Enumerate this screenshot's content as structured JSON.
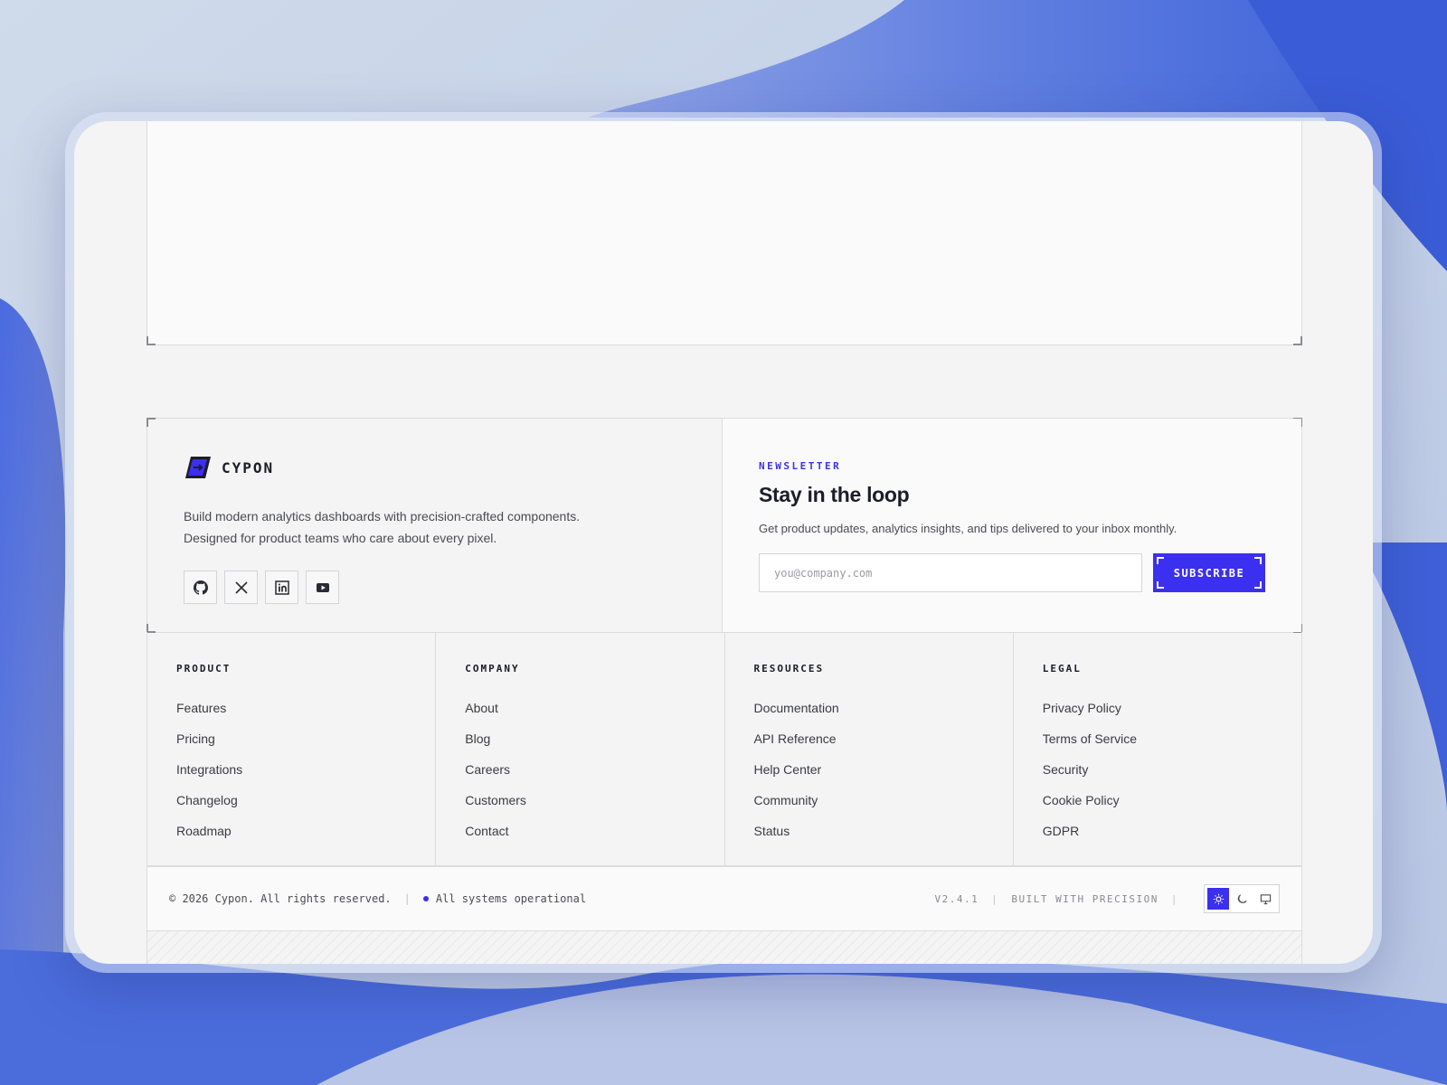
{
  "brand": {
    "name": "CYPON",
    "description": "Build modern analytics dashboards with precision-crafted components. Designed for product teams who care about every pixel.",
    "accent_color": "#3b2ff0"
  },
  "socials": [
    {
      "icon": "github-icon"
    },
    {
      "icon": "x-icon"
    },
    {
      "icon": "linkedin-icon"
    },
    {
      "icon": "youtube-icon"
    }
  ],
  "newsletter": {
    "eyebrow": "NEWSLETTER",
    "title": "Stay in the loop",
    "description": "Get product updates, analytics insights, and tips delivered to your inbox monthly.",
    "email_placeholder": "you@company.com",
    "email_value": "",
    "subscribe_label": "SUBSCRIBE"
  },
  "columns": [
    {
      "heading": "PRODUCT",
      "links": [
        "Features",
        "Pricing",
        "Integrations",
        "Changelog",
        "Roadmap"
      ]
    },
    {
      "heading": "COMPANY",
      "links": [
        "About",
        "Blog",
        "Careers",
        "Customers",
        "Contact"
      ]
    },
    {
      "heading": "RESOURCES",
      "links": [
        "Documentation",
        "API Reference",
        "Help Center",
        "Community",
        "Status"
      ]
    },
    {
      "heading": "LEGAL",
      "links": [
        "Privacy Policy",
        "Terms of Service",
        "Security",
        "Cookie Policy",
        "GDPR"
      ]
    }
  ],
  "bottom_bar": {
    "copyright": "© 2026 Cypon. All rights reserved.",
    "status": "All systems operational",
    "version": "V2.4.1",
    "tagline": "BUILT WITH PRECISION",
    "theme_options": [
      {
        "icon": "sun-icon",
        "active": true
      },
      {
        "icon": "moon-icon",
        "active": false
      },
      {
        "icon": "monitor-icon",
        "active": false
      }
    ]
  }
}
